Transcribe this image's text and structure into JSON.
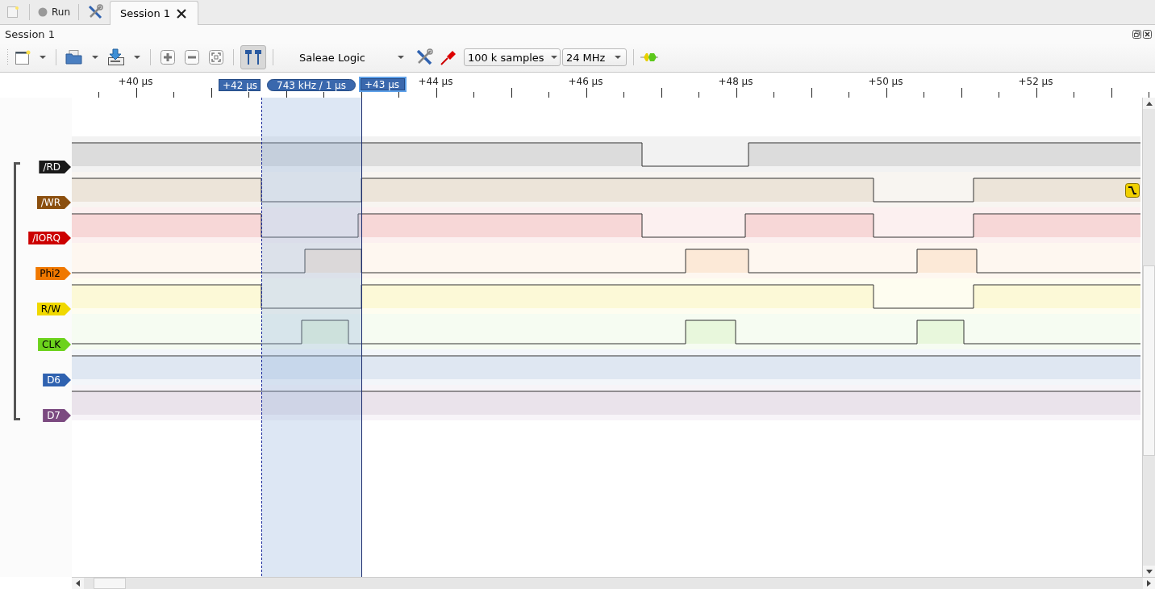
{
  "top_bar": {
    "run_button": "Run",
    "tabs": [
      {
        "label": "Session 1",
        "selected": true
      }
    ]
  },
  "panel": {
    "title": "Session 1"
  },
  "toolbar": {
    "marker_toggle": {
      "pressed": true
    },
    "device": "Saleae Logic",
    "samples": "100 k samples",
    "rate": "24 MHz"
  },
  "ruler": {
    "ticks": [
      "+40 µs",
      "+44 µs",
      "+46 µs",
      "+48 µs",
      "+50 µs",
      "+52 µs"
    ],
    "markers": [
      {
        "label": "+42 µs",
        "selected": false
      },
      {
        "label": "+43 µs",
        "selected": true
      }
    ],
    "measurement": "743 kHz / 1 µs"
  },
  "channels": [
    {
      "name": "/RD",
      "color": "#1a1a1a",
      "trigger": false
    },
    {
      "name": "/WR",
      "color": "#8b4f0e",
      "trigger": true
    },
    {
      "name": "/IORQ",
      "color": "#cc0000",
      "trigger": false
    },
    {
      "name": "Phi2",
      "color": "#f07800",
      "trigger": false
    },
    {
      "name": "R/W",
      "color": "#f0d800",
      "trigger": false
    },
    {
      "name": "CLK",
      "color": "#6cd21c",
      "trigger": false
    },
    {
      "name": "D6",
      "color": "#2f62b0",
      "trigger": false
    },
    {
      "name": "D7",
      "color": "#7b4a80",
      "trigger": false
    }
  ]
}
